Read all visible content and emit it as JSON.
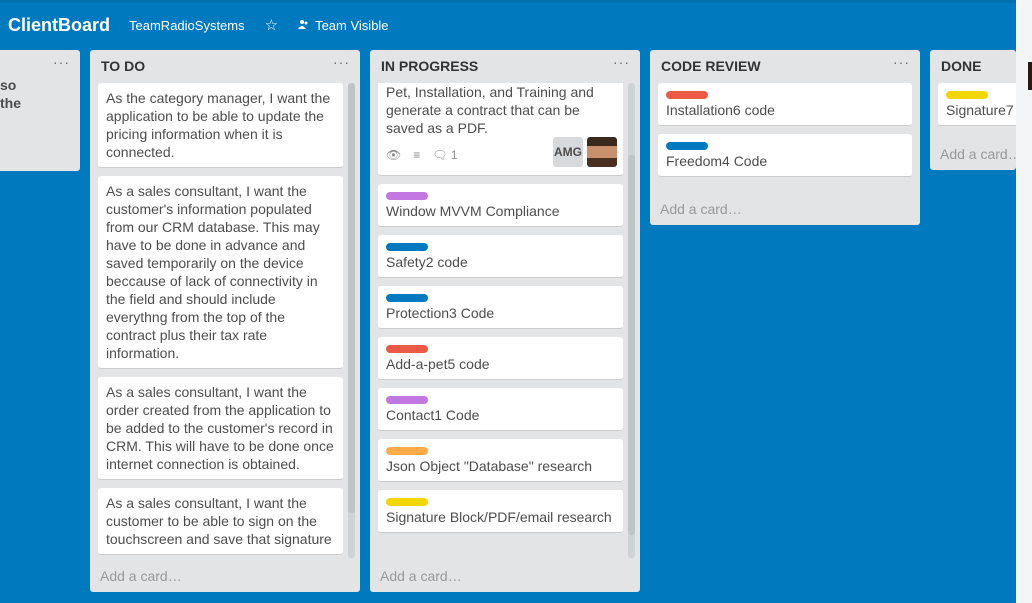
{
  "header": {
    "board_title": "ClientBoard",
    "team_name": "TeamRadioSystems",
    "visibility_label": "Team Visible"
  },
  "colors": {
    "background": "#0079bf",
    "list_background": "#e2e4e6",
    "label_purple": "#c377e0",
    "label_blue": "#0079bf",
    "label_red": "#eb5a46",
    "label_orange": "#ffab4a",
    "label_yellow": "#f2d600"
  },
  "lists": {
    "prev": {
      "fragment_1": "so",
      "fragment_2": "the"
    },
    "todo": {
      "title": "TO DO",
      "menu": "···",
      "cards": [
        {
          "text": "As the category manager, I want the application to be able to update the pricing information when it is connected."
        },
        {
          "text": "As a sales consultant, I want the customer's information populated from our CRM database. This may have to be done in advance and saved temporarily on the device beccause of lack of connectivity in the field and should include everythng from the top of the contract plus their tax rate information."
        },
        {
          "text": "As a sales consultant, I want the order created from the application to be added to the customer's record in CRM. This will have to be done once internet connection is obtained."
        },
        {
          "text": "As a sales consultant, I want the customer to be able to sign on the touchscreen and save that signature"
        }
      ],
      "add_card": "Add a card…"
    },
    "in_progress": {
      "title": "IN PROGRESS",
      "menu": "···",
      "first_card_text": "Pet, Installation, and Training and generate a contract that can be saved as a PDF.",
      "first_card_comments": "1",
      "first_card_member": "AMG",
      "cards": [
        {
          "label": "purple",
          "text": "Window MVVM Compliance"
        },
        {
          "label": "blue",
          "text": "Safety2 code"
        },
        {
          "label": "blue",
          "text": "Protection3 Code"
        },
        {
          "label": "red",
          "text": "Add-a-pet5 code"
        },
        {
          "label": "purple",
          "text": "Contact1 Code"
        },
        {
          "label": "orange",
          "text": "Json Object \"Database\" research"
        },
        {
          "label": "yellow",
          "text": "Signature Block/PDF/email research"
        }
      ],
      "add_card": "Add a card…"
    },
    "code_review": {
      "title": "CODE REVIEW",
      "menu": "···",
      "cards": [
        {
          "label": "red",
          "text": "Installation6 code"
        },
        {
          "label": "blue",
          "text": "Freedom4 Code"
        }
      ],
      "add_card": "Add a card…"
    },
    "done": {
      "title": "DONE",
      "cards": [
        {
          "label": "yellow",
          "text": "Signature7"
        }
      ],
      "add_card": "Add a card…"
    }
  }
}
